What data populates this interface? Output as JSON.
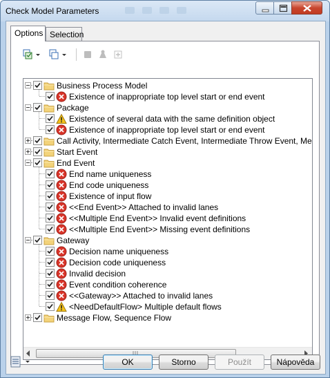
{
  "window": {
    "title": "Check Model Parameters"
  },
  "tabs": [
    {
      "label": "Options"
    },
    {
      "label": "Selection"
    }
  ],
  "tree": {
    "rows": [
      {
        "label": "Business Process Model",
        "level": 0,
        "kind": "folder",
        "expanded": true,
        "checked": true
      },
      {
        "label": "Existence of inappropriate top level start or end event",
        "level": 1,
        "kind": "error",
        "checked": true
      },
      {
        "label": "Package",
        "level": 0,
        "kind": "folder",
        "expanded": true,
        "checked": true
      },
      {
        "label": "Existence of several data with the same definition object",
        "level": 1,
        "kind": "warning",
        "checked": true
      },
      {
        "label": "Existence of inappropriate top level start or end event",
        "level": 1,
        "kind": "error",
        "checked": true
      },
      {
        "label": "Call Activity, Intermediate Catch Event, Intermediate Throw Event, Message E",
        "level": 0,
        "kind": "folder",
        "expanded": false,
        "checked": true
      },
      {
        "label": "Start Event",
        "level": 0,
        "kind": "folder",
        "expanded": false,
        "checked": true
      },
      {
        "label": "End Event",
        "level": 0,
        "kind": "folder",
        "expanded": true,
        "checked": true
      },
      {
        "label": "End name uniqueness",
        "level": 1,
        "kind": "error",
        "checked": true
      },
      {
        "label": "End code uniqueness",
        "level": 1,
        "kind": "error",
        "checked": true
      },
      {
        "label": "Existence of input flow",
        "level": 1,
        "kind": "error",
        "checked": true
      },
      {
        "label": "<<End Event>> Attached to invalid lanes",
        "level": 1,
        "kind": "error",
        "checked": true
      },
      {
        "label": "<<Multiple End Event>> Invalid event definitions",
        "level": 1,
        "kind": "error",
        "checked": true
      },
      {
        "label": "<<Multiple End Event>> Missing event definitions",
        "level": 1,
        "kind": "error",
        "checked": true
      },
      {
        "label": "Gateway",
        "level": 0,
        "kind": "folder",
        "expanded": true,
        "checked": true
      },
      {
        "label": "Decision name uniqueness",
        "level": 1,
        "kind": "error",
        "checked": true
      },
      {
        "label": "Decision code uniqueness",
        "level": 1,
        "kind": "error",
        "checked": true
      },
      {
        "label": "Invalid decision",
        "level": 1,
        "kind": "error",
        "checked": true
      },
      {
        "label": "Event condition coherence",
        "level": 1,
        "kind": "error",
        "checked": true
      },
      {
        "label": "<<Gateway>> Attached to invalid lanes",
        "level": 1,
        "kind": "error",
        "checked": true
      },
      {
        "label": "<NeedDefaultFlow> Multiple default flows",
        "level": 1,
        "kind": "warning",
        "checked": true
      },
      {
        "label": "Message Flow, Sequence Flow",
        "level": 0,
        "kind": "folder",
        "expanded": false,
        "checked": true
      }
    ]
  },
  "buttons": {
    "ok": "OK",
    "cancel": "Storno",
    "apply": "Použít",
    "help": "Nápověda"
  },
  "colors": {
    "error": "#d9352a",
    "warning": "#f3c21b",
    "folder": "#f3d37a"
  }
}
